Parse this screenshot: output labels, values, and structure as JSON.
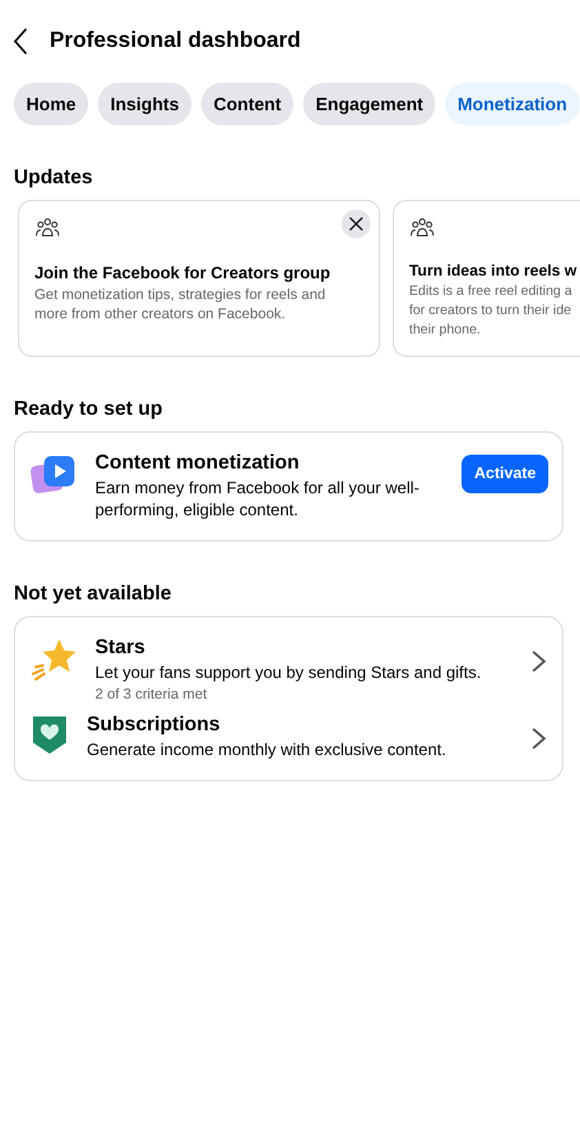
{
  "header": {
    "title": "Professional dashboard"
  },
  "tabs": [
    {
      "label": "Home",
      "selected": false
    },
    {
      "label": "Insights",
      "selected": false
    },
    {
      "label": "Content",
      "selected": false
    },
    {
      "label": "Engagement",
      "selected": false
    },
    {
      "label": "Monetization",
      "selected": true
    }
  ],
  "updates": {
    "heading": "Updates",
    "cards": [
      {
        "title": "Join the Facebook for Creators group",
        "description": "Get monetization tips, strategies for reels and\nmore from other creators on Facebook.",
        "dismissible": true
      },
      {
        "title": "Turn ideas into reels w",
        "description": "Edits is a free reel editing a\nfor creators to turn their ide\ntheir phone.",
        "dismissible": false
      }
    ]
  },
  "ready": {
    "heading": "Ready to set up",
    "item": {
      "title": "Content monetization",
      "description": "Earn money from Facebook for all your well-performing, eligible content.",
      "button": "Activate"
    }
  },
  "not_available": {
    "heading": "Not yet available",
    "items": [
      {
        "kind": "stars",
        "title": "Stars",
        "description": "Let your fans support you by sending Stars and gifts.",
        "note": "2 of 3 criteria met"
      },
      {
        "kind": "subscriptions",
        "title": "Subscriptions",
        "description": "Generate income monthly with exclusive content."
      }
    ]
  }
}
